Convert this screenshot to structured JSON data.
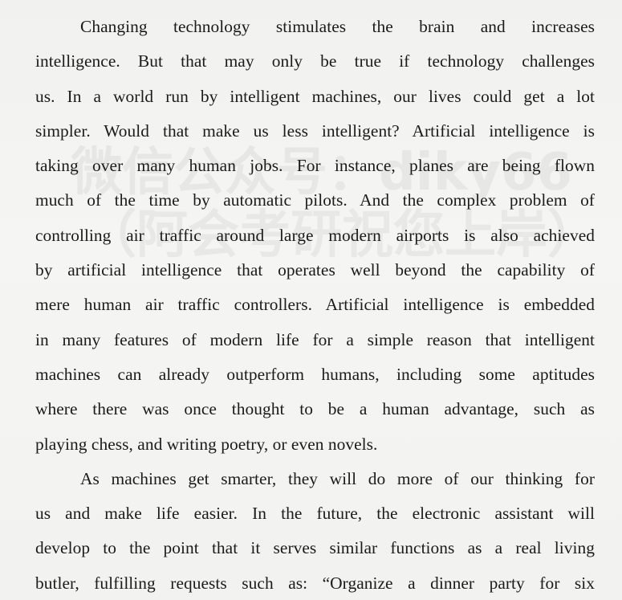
{
  "document": {
    "paragraphs": [
      {
        "lines": [
          "Changing technology stimulates the brain and increases",
          "intelligence. But that may only be true if technology challenges",
          "us. In a world run by intelligent machines, our lives could get a lot",
          "simpler. Would that make us less intelligent? Artificial intelligence is",
          "taking over many human jobs. For instance, planes are being flown",
          "much of the time by automatic pilots. And the complex problem of",
          "controlling air traffic around large modern airports is also achieved",
          "by artificial intelligence that operates well beyond the capability of",
          "mere human air traffic controllers. Artificial intelligence is embedded",
          "in many features of modern life for a simple reason that intelligent",
          "machines can already outperform humans, including some aptitudes",
          "where there was once thought to be a human advantage, such as",
          "playing chess, and writing poetry, or even novels."
        ]
      },
      {
        "lines": [
          "As machines get smarter, they will do more of our thinking for",
          "us and make life easier. In the future, the electronic assistant will",
          "develop to the point that it serves similar functions as a real living",
          "butler, fulfilling requests such as: “Organize a dinner party for six"
        ]
      }
    ]
  },
  "watermark": {
    "line1": "微信公众号：diky66",
    "line2": "（阿会考研祝您上岸）"
  }
}
